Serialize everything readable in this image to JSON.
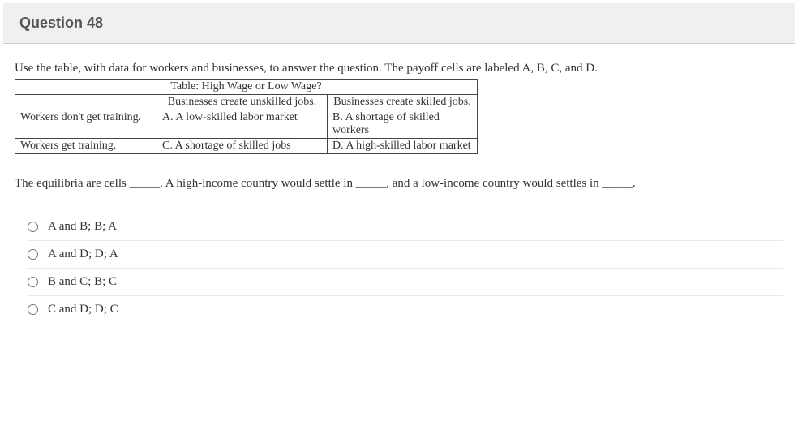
{
  "header": {
    "title": "Question 48"
  },
  "intro": "Use the table, with data for workers and businesses, to answer the question. The payoff cells are labeled A, B, C, and D.",
  "table": {
    "caption": "Table: High Wage or Low Wage?",
    "col_headers": [
      "Businesses create unskilled jobs.",
      "Businesses create skilled jobs."
    ],
    "rows": [
      {
        "label": "Workers don't get training.",
        "cells": [
          "A. A low-skilled labor market",
          "B. A shortage of skilled workers"
        ]
      },
      {
        "label": "Workers get training.",
        "cells": [
          "C. A shortage of skilled jobs",
          "D. A high-skilled labor market"
        ]
      }
    ]
  },
  "prompt": "The equilibria are cells _____. A high-income country would settle in _____, and a low-income country would settles in _____.",
  "options": [
    "A and B; B; A",
    "A and D; D; A",
    "B and C; B; C",
    "C and D; D; C"
  ]
}
